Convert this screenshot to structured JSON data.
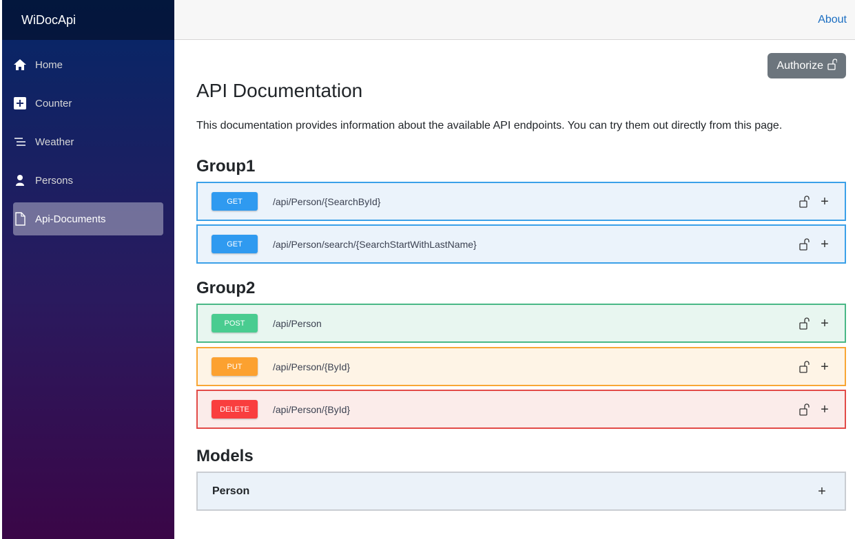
{
  "app": {
    "brand": "WiDocApi"
  },
  "sidebar": {
    "items": [
      {
        "label": "Home",
        "icon": "home-icon",
        "active": false
      },
      {
        "label": "Counter",
        "icon": "plus-square-icon",
        "active": false
      },
      {
        "label": "Weather",
        "icon": "list-lines-icon",
        "active": false
      },
      {
        "label": "Persons",
        "icon": "person-icon",
        "active": false
      },
      {
        "label": "Api-Documents",
        "icon": "json-file-icon",
        "active": true
      }
    ]
  },
  "topbar": {
    "about_label": "About"
  },
  "main": {
    "authorize_label": "Authorize",
    "title": "API Documentation",
    "intro": "This documentation provides information about the available API endpoints. You can try them out directly from this page.",
    "groups": [
      {
        "title": "Group1",
        "endpoints": [
          {
            "method": "GET",
            "path": "/api/Person/{SearchById}"
          },
          {
            "method": "GET",
            "path": "/api/Person/search/{SearchStartWithLastName}"
          }
        ]
      },
      {
        "title": "Group2",
        "endpoints": [
          {
            "method": "POST",
            "path": "/api/Person"
          },
          {
            "method": "PUT",
            "path": "/api/Person/{ById}"
          },
          {
            "method": "DELETE",
            "path": "/api/Person/{ById}"
          }
        ]
      }
    ],
    "models_title": "Models",
    "models": [
      {
        "name": "Person"
      }
    ]
  },
  "colors": {
    "get": "#2f9af0",
    "post": "#49cc90",
    "put": "#fca130",
    "delete": "#f93e3e",
    "link": "#1b6ec2"
  }
}
